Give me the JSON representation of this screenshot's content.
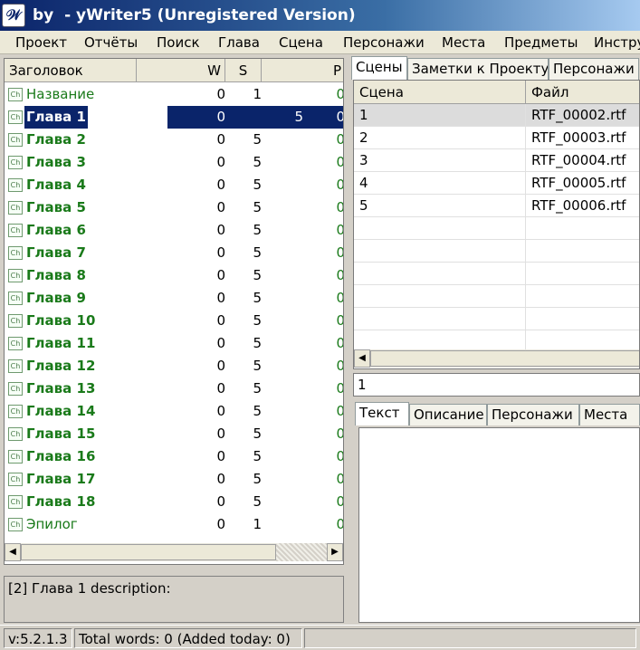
{
  "window": {
    "title": "by  - yWriter5 (Unregistered Version)"
  },
  "menu": [
    "Проект",
    "Отчёты",
    "Поиск",
    "Глава",
    "Сцена",
    "Персонажи",
    "Места",
    "Предметы",
    "Инстру"
  ],
  "chapters": {
    "columns": {
      "title": "Заголовок",
      "w": "W",
      "s": "S",
      "p": "P"
    },
    "icon_label": "Ch",
    "rows": [
      {
        "title": "Название",
        "bold": false,
        "w": "0",
        "s": "1",
        "p": "0",
        "selected": false
      },
      {
        "title": "Глава 1",
        "bold": true,
        "w": "0",
        "s": "5",
        "p": "0",
        "selected": true
      },
      {
        "title": "Глава 2",
        "bold": true,
        "w": "0",
        "s": "5",
        "p": "0",
        "selected": false
      },
      {
        "title": "Глава 3",
        "bold": true,
        "w": "0",
        "s": "5",
        "p": "0",
        "selected": false
      },
      {
        "title": "Глава 4",
        "bold": true,
        "w": "0",
        "s": "5",
        "p": "0",
        "selected": false
      },
      {
        "title": "Глава 5",
        "bold": true,
        "w": "0",
        "s": "5",
        "p": "0",
        "selected": false
      },
      {
        "title": "Глава 6",
        "bold": true,
        "w": "0",
        "s": "5",
        "p": "0",
        "selected": false
      },
      {
        "title": "Глава 7",
        "bold": true,
        "w": "0",
        "s": "5",
        "p": "0",
        "selected": false
      },
      {
        "title": "Глава 8",
        "bold": true,
        "w": "0",
        "s": "5",
        "p": "0",
        "selected": false
      },
      {
        "title": "Глава 9",
        "bold": true,
        "w": "0",
        "s": "5",
        "p": "0",
        "selected": false
      },
      {
        "title": "Глава 10",
        "bold": true,
        "w": "0",
        "s": "5",
        "p": "0",
        "selected": false
      },
      {
        "title": "Глава 11",
        "bold": true,
        "w": "0",
        "s": "5",
        "p": "0",
        "selected": false
      },
      {
        "title": "Глава 12",
        "bold": true,
        "w": "0",
        "s": "5",
        "p": "0",
        "selected": false
      },
      {
        "title": "Глава 13",
        "bold": true,
        "w": "0",
        "s": "5",
        "p": "0",
        "selected": false
      },
      {
        "title": "Глава 14",
        "bold": true,
        "w": "0",
        "s": "5",
        "p": "0",
        "selected": false
      },
      {
        "title": "Глава 15",
        "bold": true,
        "w": "0",
        "s": "5",
        "p": "0",
        "selected": false
      },
      {
        "title": "Глава 16",
        "bold": true,
        "w": "0",
        "s": "5",
        "p": "0",
        "selected": false
      },
      {
        "title": "Глава 17",
        "bold": true,
        "w": "0",
        "s": "5",
        "p": "0",
        "selected": false
      },
      {
        "title": "Глава 18",
        "bold": true,
        "w": "0",
        "s": "5",
        "p": "0",
        "selected": false
      },
      {
        "title": "Эпилог",
        "bold": false,
        "w": "0",
        "s": "1",
        "p": "0",
        "selected": false
      }
    ]
  },
  "description": "[2] Глава 1 description:",
  "status": {
    "version": "v:5.2.1.3",
    "words": "Total words: 0 (Added today: 0)"
  },
  "top_tabs": [
    {
      "label": "Сцены",
      "active": true
    },
    {
      "label": "Заметки к Проекту",
      "active": false
    },
    {
      "label": "Персонажи",
      "active": false
    }
  ],
  "scenes": {
    "columns": {
      "scene": "Сцена",
      "file": "Файл"
    },
    "rows": [
      {
        "scene": "1",
        "file": "RTF_00002.rtf",
        "selected": true
      },
      {
        "scene": "2",
        "file": "RTF_00003.rtf",
        "selected": false
      },
      {
        "scene": "3",
        "file": "RTF_00004.rtf",
        "selected": false
      },
      {
        "scene": "4",
        "file": "RTF_00005.rtf",
        "selected": false
      },
      {
        "scene": "5",
        "file": "RTF_00006.rtf",
        "selected": false
      }
    ],
    "empty_rows": 6
  },
  "scene_field_value": "1",
  "bottom_tabs": [
    {
      "label": "Текст",
      "active": true
    },
    {
      "label": "Описание",
      "active": false
    },
    {
      "label": "Персонажи",
      "active": false
    },
    {
      "label": "Места",
      "active": false
    }
  ],
  "icons": {
    "app": "quill-icon",
    "scroll_left": "arrow-left-icon",
    "scroll_right": "arrow-right-icon"
  }
}
